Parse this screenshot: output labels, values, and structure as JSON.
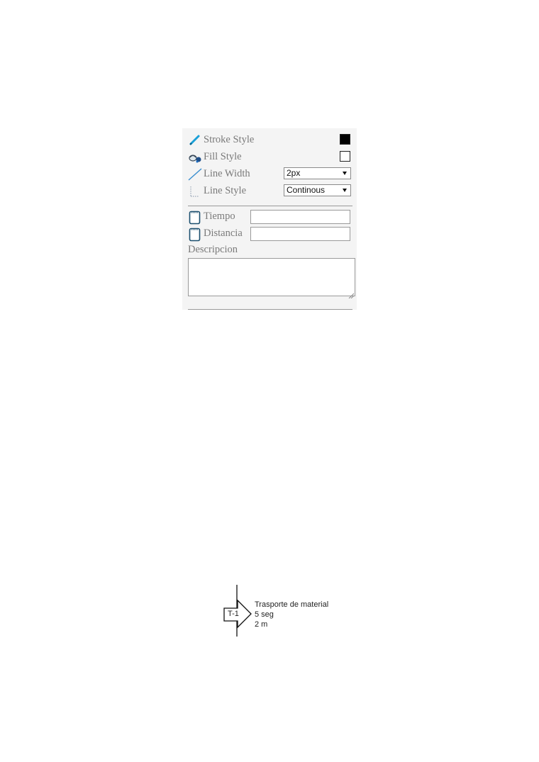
{
  "panel": {
    "stroke_style": {
      "label": "Stroke Style",
      "icon": "pen-icon",
      "color": "#000000"
    },
    "fill_style": {
      "label": "Fill Style",
      "icon": "paint-bucket-icon",
      "color": "#ffffff"
    },
    "line_width": {
      "label": "Line Width",
      "icon": "diagonal-line-icon",
      "value": "2px"
    },
    "line_style": {
      "label": "Line Style",
      "icon": "dotted-line-icon",
      "value": "Continous"
    },
    "tiempo": {
      "label": "Tiempo",
      "icon": "notepad-icon",
      "value": ""
    },
    "distancia": {
      "label": "Distancia",
      "icon": "notepad-icon",
      "value": ""
    },
    "descripcion": {
      "label": "Descripcion",
      "value": ""
    }
  },
  "diagram": {
    "symbol_label": "T-1",
    "title": "Trasporte de material",
    "time": "5 seg",
    "distance": "2 m"
  }
}
